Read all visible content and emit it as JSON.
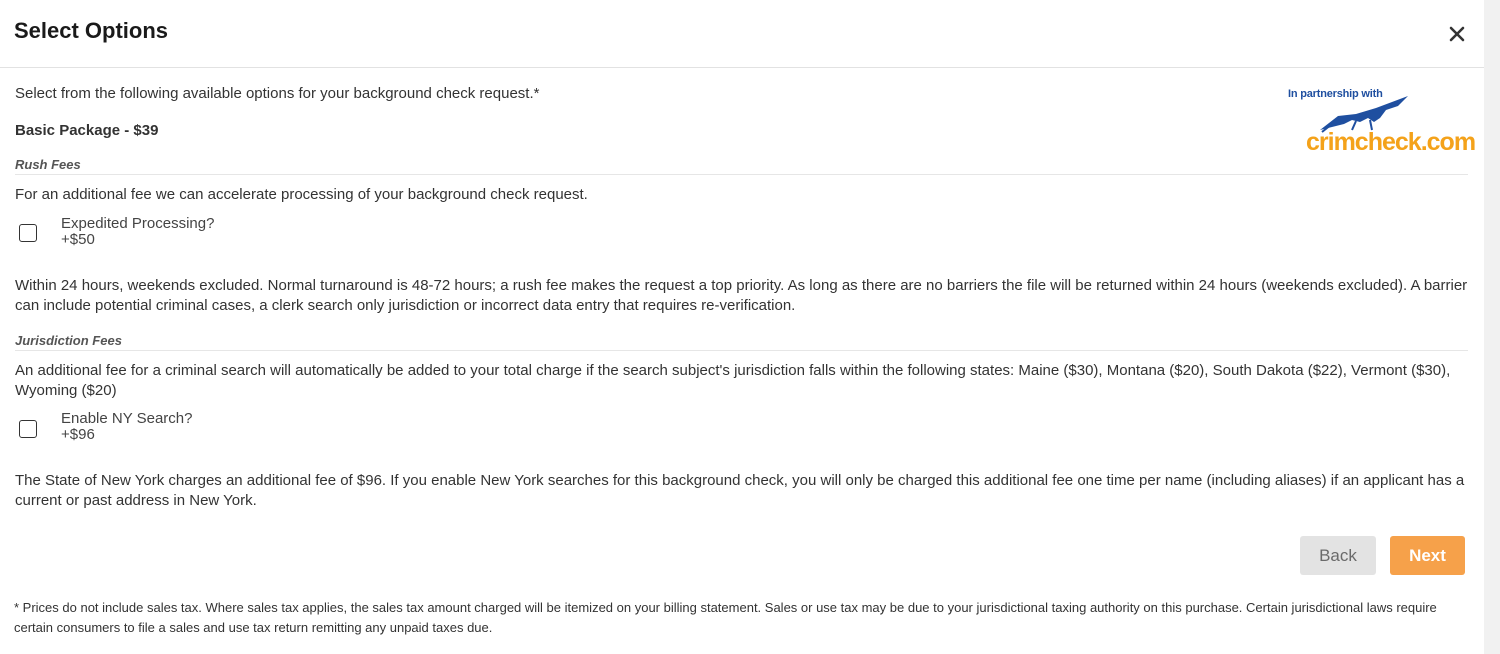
{
  "modal": {
    "title": "Select Options",
    "close_icon": "close-icon"
  },
  "intro_text": "Select from the following available options for your background check request.*",
  "package_label": "Basic Package - $39",
  "logo": {
    "partner_text": "In partnership with",
    "brand_text": "crimcheck.com"
  },
  "rush": {
    "section_label": "Rush Fees",
    "description": "For an additional fee we can accelerate processing of your background check request.",
    "option": {
      "label": "Expedited Processing?",
      "price": "+$50",
      "checked": false
    },
    "details": "Within 24 hours, weekends excluded. Normal turnaround is 48-72 hours; a rush fee makes the request a top priority. As long as there are no barriers the file will be returned within 24 hours (weekends excluded). A barrier can include potential criminal cases, a clerk search only jurisdiction or incorrect data entry that requires re-verification."
  },
  "jurisdiction": {
    "section_label": "Jurisdiction Fees",
    "description": "An additional fee for a criminal search will automatically be added to your total charge if the search subject's jurisdiction falls within the following states: Maine ($30), Montana ($20), South Dakota ($22), Vermont ($30), Wyoming ($20)",
    "option": {
      "label": "Enable NY Search?",
      "price": "+$96",
      "checked": false
    },
    "details": "The State of New York charges an additional fee of $96. If you enable New York searches for this background check, you will only be charged this additional fee one time per name (including aliases) if an applicant has a current or past address in New York."
  },
  "buttons": {
    "back_label": "Back",
    "next_label": "Next"
  },
  "footnote": "* Prices do not include sales tax. Where sales tax applies, the sales tax amount charged will be itemized on your billing statement. Sales or use tax may be due to your jurisdictional taxing authority on this purchase. Certain jurisdictional laws require certain consumers to file a sales and use tax return remitting any unpaid taxes due.",
  "colors": {
    "accent": "#f6a14a",
    "logo_blue": "#1f4fa0",
    "logo_orange": "#f4a21a"
  }
}
